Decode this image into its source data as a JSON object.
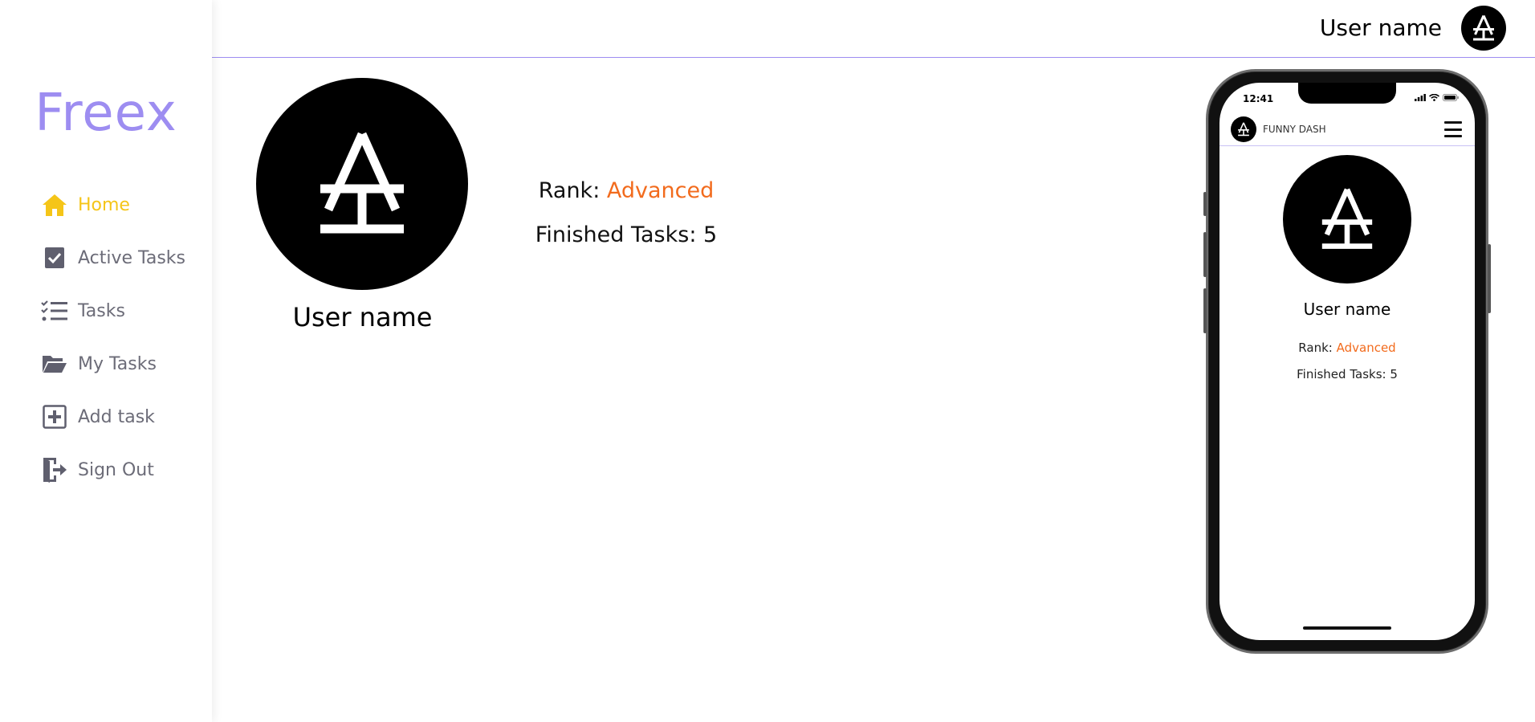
{
  "app": {
    "brand": "Freex",
    "accent_color": "#9d8df1",
    "active_color": "#f5c518",
    "rank_color": "#f26b1d"
  },
  "sidebar": {
    "items": [
      {
        "label": "Home",
        "icon": "home-icon",
        "active": true
      },
      {
        "label": "Active Tasks",
        "icon": "checkbox-icon",
        "active": false
      },
      {
        "label": "Tasks",
        "icon": "task-list-icon",
        "active": false
      },
      {
        "label": "My Tasks",
        "icon": "folder-open-icon",
        "active": false
      },
      {
        "label": "Add task",
        "icon": "plus-square-icon",
        "active": false
      },
      {
        "label": "Sign Out",
        "icon": "sign-out-icon",
        "active": false
      }
    ]
  },
  "header": {
    "user_name": "User name",
    "avatar_icon": "brand-logo-icon"
  },
  "profile": {
    "user_name": "User name",
    "rank_label": "Rank: ",
    "rank_value": "Advanced",
    "finished_label": "Finished Tasks: ",
    "finished_value": "5"
  },
  "phone_preview": {
    "status_time": "12:41",
    "app_title": "FUNNY DASH",
    "user_name": "User name",
    "rank_label": "Rank: ",
    "rank_value": "Advanced",
    "finished_label": "Finished Tasks: ",
    "finished_value": "5"
  }
}
